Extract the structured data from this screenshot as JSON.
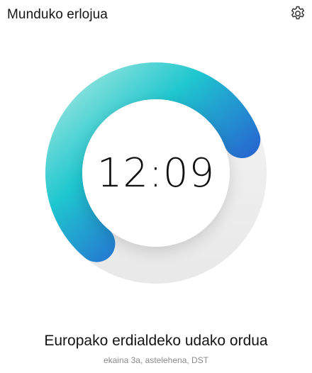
{
  "header": {
    "title": "Munduko erlojua",
    "settings_icon": "gear-icon"
  },
  "clock": {
    "time": "12:09",
    "dial_fill_fraction": 0.58,
    "colors": {
      "gradient_start": "#9be6dd",
      "gradient_mid": "#1fc7cf",
      "gradient_end": "#2b2fd1",
      "track": "#ececec"
    }
  },
  "zone": {
    "name": "Europako erdialdeko udako ordua",
    "detail": "ekaina 3a, astelehena, DST"
  }
}
